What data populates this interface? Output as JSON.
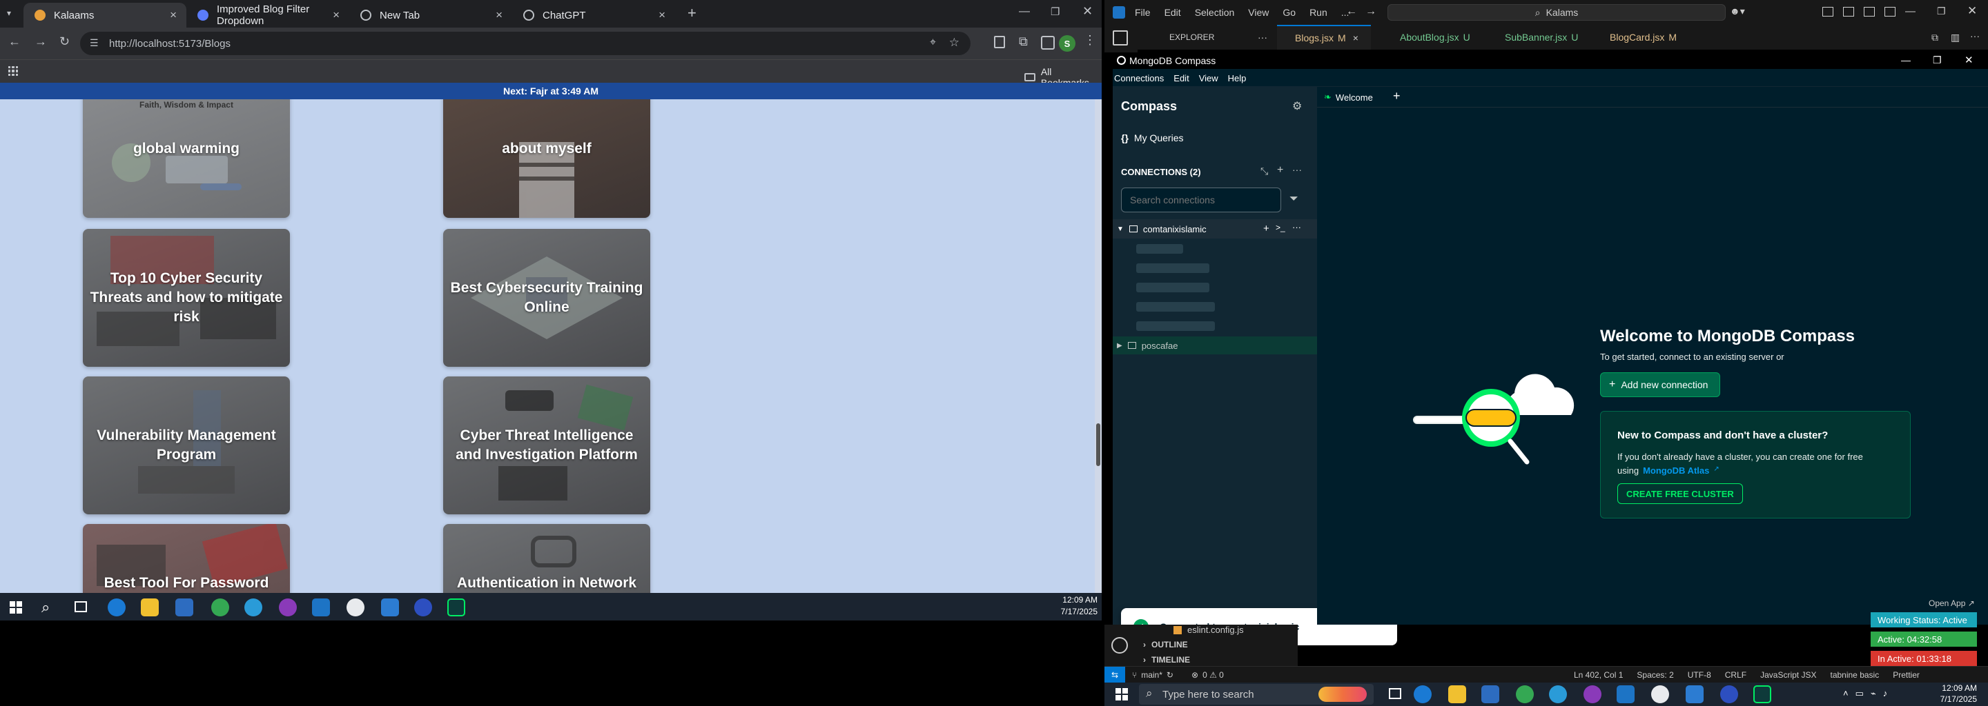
{
  "chrome": {
    "tabs": [
      {
        "title": "Kalaams",
        "icon_color": "#e8a03c",
        "active": true
      },
      {
        "title": "Improved Blog Filter Dropdown",
        "icon_color": "#5b7cfa",
        "active": false
      },
      {
        "title": "New Tab",
        "icon_color": "#bdc1c6",
        "active": false
      },
      {
        "title": "ChatGPT",
        "icon_color": "#bdc1c6",
        "active": false
      }
    ],
    "url": "http://localhost:5173/Blogs",
    "all_bookmarks": "All Bookmarks",
    "profile_initial": "S"
  },
  "site": {
    "prayer_banner": "Next: Fajr at 3:49 AM",
    "cards": [
      {
        "title": "global warming",
        "caption": "Faith, Wisdom & Impact"
      },
      {
        "title": "about myself"
      },
      {
        "title": "Top 10 Cyber Security Threats and how to mitigate risk"
      },
      {
        "title": "Best Cybersecurity Training Online"
      },
      {
        "title": "Vulnerability Management Program"
      },
      {
        "title": "Cyber Threat Intelligence and Investigation Platform"
      },
      {
        "title": "Best Tool For Password Management"
      },
      {
        "title": "Authentication in Network Security"
      }
    ]
  },
  "taskbar_left": {
    "time": "12:09 AM",
    "date": "7/17/2025"
  },
  "vscode": {
    "menu": [
      "File",
      "Edit",
      "Selection",
      "View",
      "Go",
      "Run",
      "..."
    ],
    "search": "Kalams",
    "explorer_label": "EXPLORER",
    "tabs": [
      {
        "name": "Blogs.jsx",
        "badge": "M"
      },
      {
        "name": "AboutBlog.jsx",
        "badge": "U"
      },
      {
        "name": "SubBanner.jsx",
        "badge": "U"
      },
      {
        "name": "BlogCard.jsx",
        "badge": "M"
      }
    ],
    "file_item": "eslint.config.js",
    "outline": "OUTLINE",
    "timeline": "TIMELINE",
    "status": {
      "branch": "main*",
      "problems": "0 ⚠ 0",
      "position": "Ln 402, Col 1",
      "spaces": "Spaces: 2",
      "encoding": "UTF-8",
      "eol": "CRLF",
      "language": "JavaScript JSX",
      "tabnine": "tabnine basic",
      "prettier": "Prettier"
    }
  },
  "compass": {
    "window_title": "MongoDB Compass",
    "menu": [
      "Connections",
      "Edit",
      "View",
      "Help"
    ],
    "sidebar_title": "Compass",
    "my_queries": "My Queries",
    "connections_label": "CONNECTIONS (2)",
    "search_placeholder": "Search connections",
    "connections": [
      {
        "name": "comtanixislamic",
        "expanded": true
      },
      {
        "name": "poscafae",
        "expanded": false
      }
    ],
    "welcome_tab": "Welcome",
    "welcome_title": "Welcome to MongoDB Compass",
    "welcome_sub": "To get started, connect to an existing server or",
    "add_connection": "Add new connection",
    "atlas_title": "New to Compass and don't have a cluster?",
    "atlas_text_1": "If you don't already have a cluster, you can create one for free",
    "atlas_text_2": "using",
    "atlas_link": "MongoDB Atlas",
    "create_cluster": "CREATE FREE CLUSTER",
    "toast": "Connected to comtanixislamic",
    "accent": "#00ed64",
    "button_green": "#00684a"
  },
  "timer": {
    "open_app": "Open App",
    "working_status": "Working Status: Active",
    "active": "Active: 04:32:58",
    "inactive": "In Active: 01:33:18"
  },
  "taskbar_right": {
    "search_placeholder": "Type here to search",
    "time": "12:09 AM",
    "date": "7/17/2025"
  }
}
